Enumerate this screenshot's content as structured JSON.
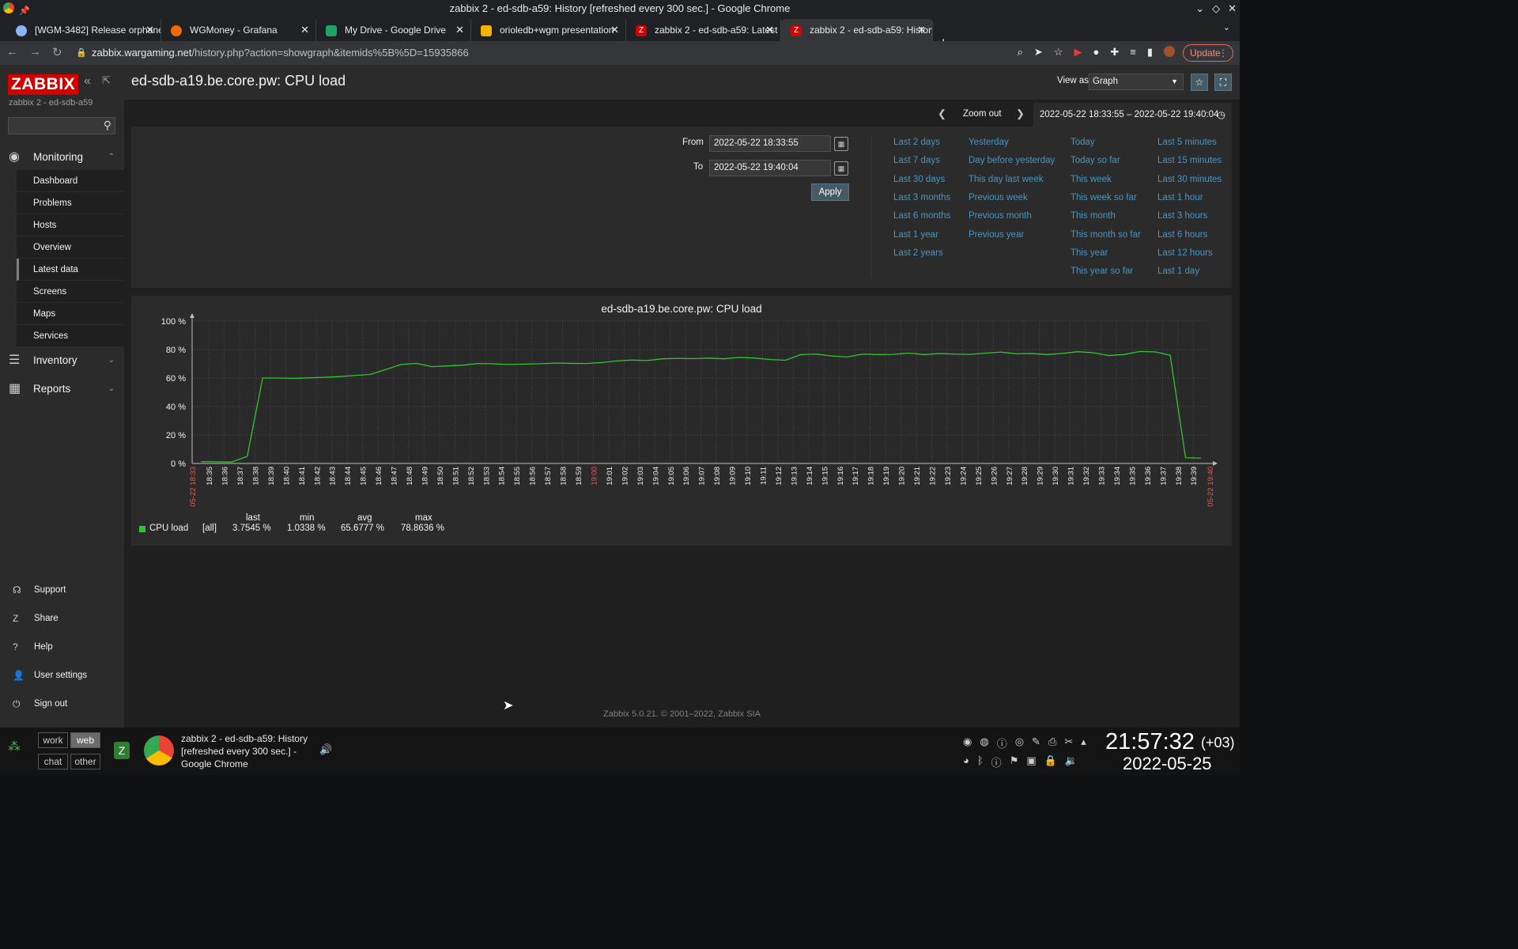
{
  "window": {
    "title": "zabbix 2 - ed-sdb-a59: History [refreshed every 300 sec.] - Google Chrome",
    "controls": [
      "⌄",
      "◇",
      "✕"
    ]
  },
  "tabs": [
    {
      "label": "[WGM-3482] Release orphane",
      "icon_color": "#8ab4f8"
    },
    {
      "label": "WGMoney - Grafana",
      "icon_color": "#f46800"
    },
    {
      "label": "My Drive - Google Drive",
      "icon_color": "#1fa463"
    },
    {
      "label": "orioledb+wgm presentation",
      "icon_color": "#f4b400"
    },
    {
      "label": "zabbix 2 - ed-sdb-a59: Latest",
      "icon_color": "#d40000"
    },
    {
      "label": "zabbix 2 - ed-sdb-a59: History",
      "icon_color": "#d40000"
    }
  ],
  "omnibox": {
    "domain": "zabbix.wargaming.net",
    "path": "/history.php?action=showgraph&itemids%5B%5D=15935866",
    "update_label": "Update"
  },
  "sidebar": {
    "logo": "ZABBIX",
    "server_name": "zabbix 2 - ed-sdb-a59",
    "search_placeholder": "",
    "monitoring": "Monitoring",
    "monitoring_items": [
      "Dashboard",
      "Problems",
      "Hosts",
      "Overview",
      "Latest data",
      "Screens",
      "Maps",
      "Services"
    ],
    "selected_item": "Latest data",
    "inventory": "Inventory",
    "reports": "Reports",
    "bottom": [
      "Support",
      "Share",
      "Help",
      "User settings",
      "Sign out"
    ]
  },
  "header": {
    "title": "ed-sdb-a19.be.core.pw: CPU load",
    "view_as_label": "View as",
    "view_as_value": "Graph"
  },
  "timebar": {
    "zoom_out": "Zoom out",
    "range": "2022-05-22 18:33:55 – 2022-05-22 19:40:04"
  },
  "filter": {
    "from_label": "From",
    "from_value": "2022-05-22 18:33:55",
    "to_label": "To",
    "to_value": "2022-05-22 19:40:04",
    "apply": "Apply",
    "quick_columns": [
      [
        "Last 2 days",
        "Last 7 days",
        "Last 30 days",
        "Last 3 months",
        "Last 6 months",
        "Last 1 year",
        "Last 2 years"
      ],
      [
        "Yesterday",
        "Day before yesterday",
        "This day last week",
        "Previous week",
        "Previous month",
        "Previous year"
      ],
      [
        "Today",
        "Today so far",
        "This week",
        "This week so far",
        "This month",
        "This month so far",
        "This year",
        "This year so far"
      ],
      [
        "Last 5 minutes",
        "Last 15 minutes",
        "Last 30 minutes",
        "Last 1 hour",
        "Last 3 hours",
        "Last 6 hours",
        "Last 12 hours",
        "Last 1 day"
      ]
    ]
  },
  "chart_data": {
    "type": "line",
    "title": "ed-sdb-a19.be.core.pw: CPU load",
    "ylabel": "",
    "xlabel": "",
    "ylim": [
      0,
      100
    ],
    "y_ticks": [
      "0 %",
      "20 %",
      "40 %",
      "60 %",
      "80 %",
      "100 %"
    ],
    "x_start_label": "05-22 18:33",
    "x_end_label": "05-22 19:40",
    "x_ticks": [
      "18:35",
      "18:36",
      "18:37",
      "18:38",
      "18:39",
      "18:40",
      "18:41",
      "18:42",
      "18:43",
      "18:44",
      "18:45",
      "18:46",
      "18:47",
      "18:48",
      "18:49",
      "18:50",
      "18:51",
      "18:52",
      "18:53",
      "18:54",
      "18:55",
      "18:56",
      "18:57",
      "18:58",
      "18:59",
      "19:00",
      "19:01",
      "19:02",
      "19:03",
      "19:04",
      "19:05",
      "19:06",
      "19:07",
      "19:08",
      "19:09",
      "19:10",
      "19:11",
      "19:12",
      "19:13",
      "19:14",
      "19:15",
      "19:16",
      "19:17",
      "19:18",
      "19:19",
      "19:20",
      "19:21",
      "19:22",
      "19:23",
      "19:24",
      "19:25",
      "19:26",
      "19:27",
      "19:28",
      "19:29",
      "19:30",
      "19:31",
      "19:32",
      "19:33",
      "19:34",
      "19:35",
      "19:36",
      "19:37",
      "19:38",
      "19:39"
    ],
    "x_minutes": [
      "18:34",
      "18:35",
      "18:36",
      "18:37",
      "18:38",
      "18:39",
      "18:40",
      "18:41",
      "18:42",
      "18:43",
      "18:44",
      "18:45",
      "18:46",
      "18:47",
      "18:48",
      "18:49",
      "18:50",
      "18:51",
      "18:52",
      "18:53",
      "18:54",
      "18:55",
      "18:56",
      "18:57",
      "18:58",
      "18:59",
      "19:00",
      "19:01",
      "19:02",
      "19:03",
      "19:04",
      "19:05",
      "19:06",
      "19:07",
      "19:08",
      "19:09",
      "19:10",
      "19:11",
      "19:12",
      "19:13",
      "19:14",
      "19:15",
      "19:16",
      "19:17",
      "19:18",
      "19:19",
      "19:20",
      "19:21",
      "19:22",
      "19:23",
      "19:24",
      "19:25",
      "19:26",
      "19:27",
      "19:28",
      "19:29",
      "19:30",
      "19:31",
      "19:32",
      "19:33",
      "19:34",
      "19:35",
      "19:36",
      "19:37",
      "19:38",
      "19:39"
    ],
    "series": [
      {
        "name": "CPU load",
        "color": "#2fc62f",
        "values": [
          1.3,
          1.1,
          1.0,
          5,
          60,
          60,
          59.8,
          60.1,
          60.5,
          61,
          61.8,
          62.5,
          66,
          69.5,
          70.3,
          68,
          68.5,
          69,
          70.2,
          70,
          69.5,
          69.8,
          70,
          70.5,
          70.3,
          70.2,
          70.8,
          72,
          72.6,
          72.3,
          73.5,
          73.8,
          73.6,
          74,
          73.5,
          74.5,
          74,
          73,
          72.5,
          76.5,
          76.8,
          75.5,
          74.8,
          76.8,
          76.5,
          76.6,
          77.5,
          76.5,
          77.2,
          76.8,
          76.6,
          77.5,
          78.2,
          77,
          77.2,
          76.5,
          77.3,
          78.5,
          77.8,
          75.8,
          76.5,
          78.6,
          78.4,
          76,
          4,
          3.75
        ]
      }
    ],
    "legend": {
      "item": "CPU load",
      "func": "[all]",
      "headers": [
        "last",
        "min",
        "avg",
        "max"
      ],
      "values": [
        "3.7545 %",
        "1.0338 %",
        "65.6777 %",
        "78.8636 %"
      ]
    }
  },
  "footer": {
    "text": "Zabbix 5.0.21. © 2001–2022,",
    "link": "Zabbix SIA"
  },
  "taskbar": {
    "workspaces": [
      "work",
      "web",
      "chat",
      "other"
    ],
    "active_workspace": "web",
    "task_title": "zabbix 2 - ed-sdb-a59: History [refreshed every 300 sec.] - Google Chrome",
    "time": "21:57:32",
    "tz": "(+03)",
    "date": "2022-05-25"
  }
}
